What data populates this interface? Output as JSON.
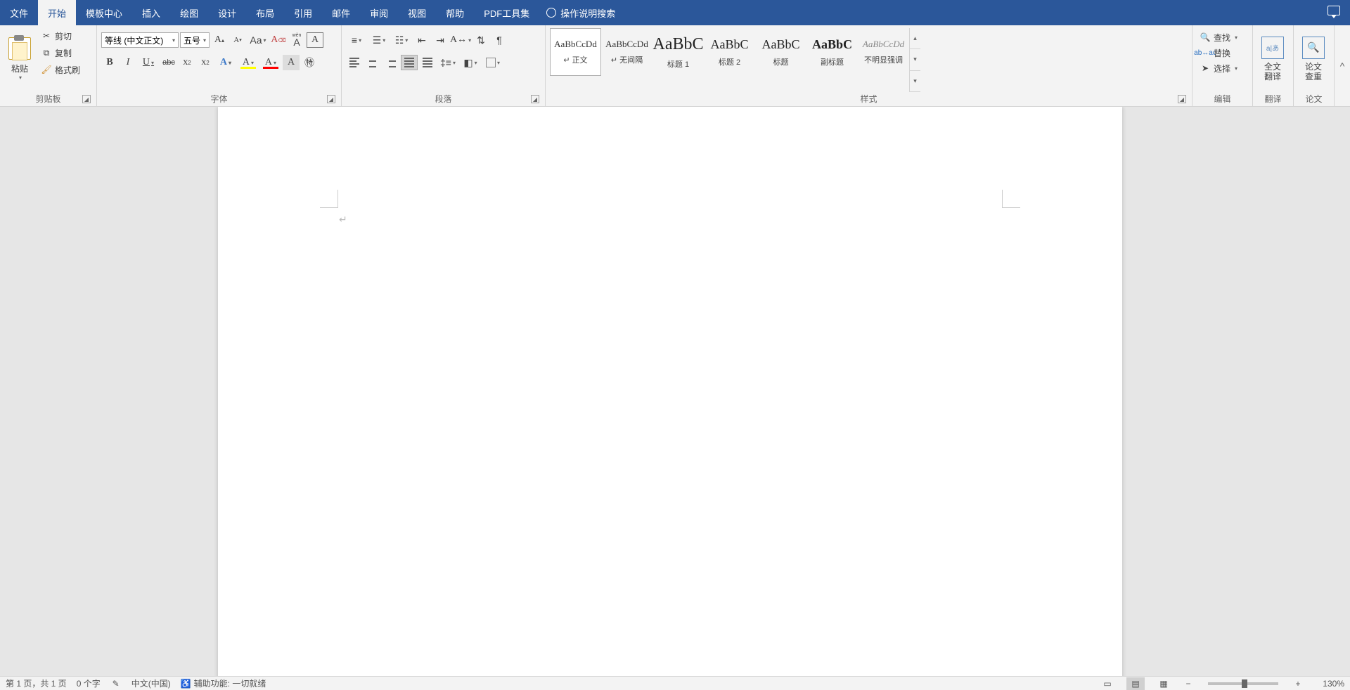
{
  "menu": {
    "file": "文件",
    "home": "开始",
    "template": "模板中心",
    "insert": "插入",
    "draw": "绘图",
    "design": "设计",
    "layout": "布局",
    "references": "引用",
    "mail": "邮件",
    "review": "审阅",
    "view": "视图",
    "help": "帮助",
    "pdf": "PDF工具集",
    "tell_me": "操作说明搜索"
  },
  "clipboard": {
    "paste": "粘贴",
    "cut": "剪切",
    "copy": "复制",
    "format_painter": "格式刷",
    "group": "剪贴板"
  },
  "font": {
    "name": "等线 (中文正文)",
    "size": "五号",
    "group": "字体"
  },
  "paragraph": {
    "group": "段落"
  },
  "styles": {
    "group": "样式",
    "items": [
      {
        "preview": "AaBbCcDd",
        "label": "↵ 正文",
        "size": "13px",
        "weight": "400",
        "color": "#333"
      },
      {
        "preview": "AaBbCcDd",
        "label": "↵ 无间隔",
        "size": "13px",
        "weight": "400",
        "color": "#333"
      },
      {
        "preview": "AaBbC",
        "label": "标题 1",
        "size": "24px",
        "weight": "400",
        "color": "#222"
      },
      {
        "preview": "AaBbC",
        "label": "标题 2",
        "size": "18px",
        "weight": "400",
        "color": "#222"
      },
      {
        "preview": "AaBbC",
        "label": "标题",
        "size": "18px",
        "weight": "400",
        "color": "#222"
      },
      {
        "preview": "AaBbC",
        "label": "副标题",
        "size": "18px",
        "weight": "700",
        "color": "#222"
      },
      {
        "preview": "AaBbCcDd",
        "label": "不明显强调",
        "size": "13px",
        "weight": "400",
        "color": "#888",
        "italic": true
      }
    ]
  },
  "editing": {
    "find": "查找",
    "replace": "替换",
    "select": "选择",
    "group": "编辑"
  },
  "translate": {
    "label": "全文\n翻译",
    "group": "翻译"
  },
  "thesis": {
    "label": "论文\n查重",
    "group": "论文"
  },
  "status": {
    "page": "第 1 页，共 1 页",
    "words": "0 个字",
    "language": "中文(中国)",
    "accessibility": "辅助功能: 一切就绪",
    "zoom": "130%"
  }
}
